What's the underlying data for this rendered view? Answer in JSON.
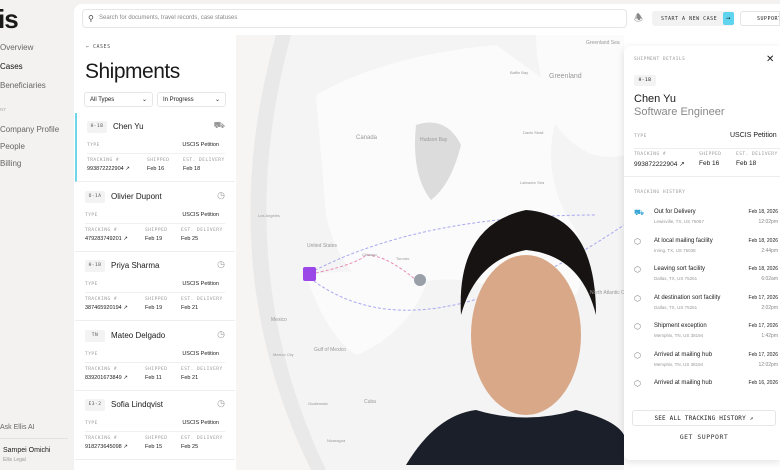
{
  "sidebar": {
    "logo": "is",
    "items": [
      {
        "label": "Overview"
      },
      {
        "label": "Cases"
      },
      {
        "label": "Beneficiaries"
      }
    ],
    "section": "NT",
    "items2": [
      {
        "label": "Company Profile"
      },
      {
        "label": "People"
      },
      {
        "label": "Billing"
      }
    ],
    "ask": "Ask Ellis AI",
    "user": {
      "name": "Sampei Omichi",
      "org": "Ellis Legal"
    }
  },
  "topbar": {
    "search_placeholder": "Search for documents, travel records, case statuses",
    "new_case": "START A NEW CASE",
    "new_case_arrow": "→",
    "support": "SUPPORT"
  },
  "list": {
    "back": "CASES",
    "title": "Shipments",
    "filters": [
      "All Types",
      "In Progress"
    ],
    "labels": {
      "type": "TYPE",
      "tracking": "TRACKING #",
      "shipped": "SHIPPED",
      "delivery": "EST. DELIVERY"
    },
    "cards": [
      {
        "badge": "H-1B",
        "name": "Chen Yu",
        "type": "USCIS Petition",
        "tracking": "993872222904",
        "shipped": "Feb 16",
        "delivery": "Feb 18",
        "status": "truck"
      },
      {
        "badge": "O-1A",
        "name": "Olivier Dupont",
        "type": "USCIS Petition",
        "tracking": "479283749201",
        "shipped": "Feb 19",
        "delivery": "Feb 25",
        "status": "clock"
      },
      {
        "badge": "H-1B",
        "name": "Priya Sharma",
        "type": "USCIS Petition",
        "tracking": "387465920194",
        "shipped": "Feb 19",
        "delivery": "Feb 21",
        "status": "clock"
      },
      {
        "badge": "TN",
        "name": "Mateo Delgado",
        "type": "USCIS Petition",
        "tracking": "839201673849",
        "shipped": "Feb 11",
        "delivery": "Feb 21",
        "status": "clock"
      },
      {
        "badge": "E3-2",
        "name": "Sofia Lindqvist",
        "type": "USCIS Petition",
        "tracking": "918273645098",
        "shipped": "Feb 15",
        "delivery": "Feb 25",
        "status": "clock"
      }
    ]
  },
  "map": {
    "labels": [
      "Greenland",
      "Greenland Sea",
      "Baffin Bay",
      "Davis Strait",
      "Labrador Sea",
      "Hudson Bay",
      "Canada",
      "United States",
      "Chicago",
      "Toronto",
      "Mexico",
      "Mexico City",
      "Gulf of Mexico",
      "Cuba",
      "Guatemala",
      "Nicaragua",
      "Los Angeles",
      "North Atlantic Ocean"
    ]
  },
  "detail": {
    "header": "SHIPMENT DETAILS",
    "close": "✕",
    "badge": "H-1B",
    "name": "Chen Yu",
    "role": "Software Engineer",
    "type_label": "TYPE",
    "type": "USCIS Petition",
    "tracking_label": "TRACKING #",
    "tracking": "993872222904",
    "shipped_label": "SHIPPED",
    "shipped": "Feb 16",
    "delivery_label": "EST. DELIVERY",
    "delivery": "Feb 18",
    "history_label": "TRACKING HISTORY",
    "history": [
      {
        "title": "Out for Delivery",
        "loc": "Lewisville, TX, US 75067",
        "date": "Feb 18, 2026",
        "time": "12:02pm"
      },
      {
        "title": "At local mailing facility",
        "loc": "Irving, TX, US 75038",
        "date": "Feb 18, 2026",
        "time": "2:44pm"
      },
      {
        "title": "Leaving sort facility",
        "loc": "Dallas, TX, US 75261",
        "date": "Feb 18, 2026",
        "time": "6:02am"
      },
      {
        "title": "At destination sort facility",
        "loc": "Dallas, TX, US 75261",
        "date": "Feb 17, 2026",
        "time": "2:02pm"
      },
      {
        "title": "Shipment exception",
        "loc": "Memphis, TN, US 38194",
        "date": "Feb 17, 2026",
        "time": "1:42pm"
      },
      {
        "title": "Arrived at mailing hub",
        "loc": "Memphis, TN, US 38194",
        "date": "Feb 17, 2026",
        "time": "12:02pm"
      },
      {
        "title": "Arrived at mailing hub",
        "loc": "",
        "date": "Feb 16, 2026",
        "time": ""
      }
    ],
    "see_all": "SEE ALL TRACKING HISTORY",
    "get_support": "GET SUPPORT"
  }
}
